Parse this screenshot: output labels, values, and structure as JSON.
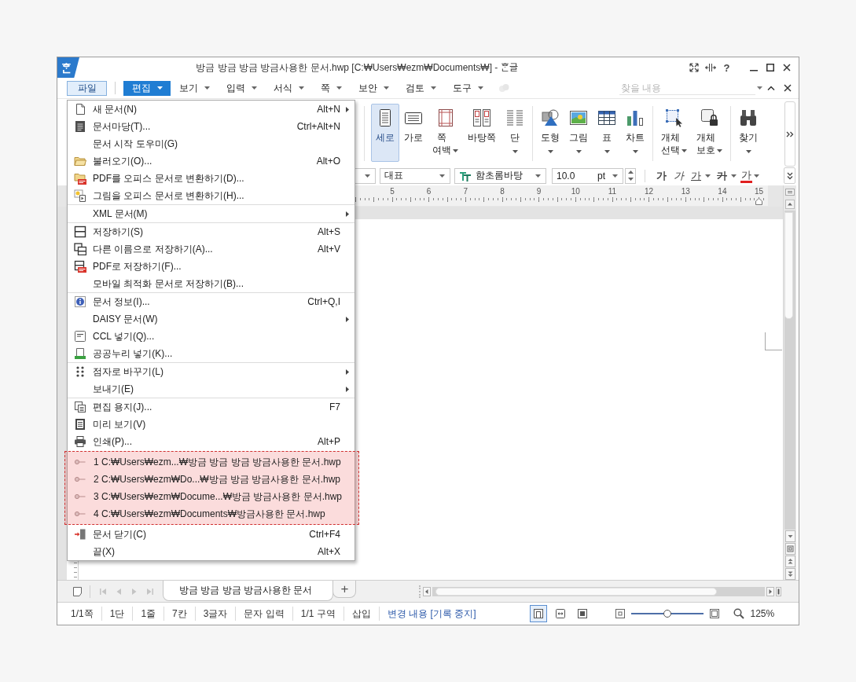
{
  "window": {
    "logo": "ᄒᆞᆫ",
    "title": "방금 방금 방금 방금사용한 문서.hwp [C:₩Users₩ezm₩Documents₩] - ᄒᆞᆫ글",
    "help": "?"
  },
  "menubar": {
    "file_button": "파일",
    "menus": [
      {
        "label": "편집",
        "selected": true
      },
      {
        "label": "보기",
        "selected": false
      },
      {
        "label": "입력",
        "selected": false
      },
      {
        "label": "서식",
        "selected": false
      },
      {
        "label": "쪽",
        "selected": false
      },
      {
        "label": "보안",
        "selected": false
      },
      {
        "label": "검토",
        "selected": false
      },
      {
        "label": "도구",
        "selected": false
      }
    ],
    "search": {
      "placeholder": "찾을 내용"
    }
  },
  "ribbon": {
    "groups": [
      [
        {
          "label": "세로",
          "selected": true,
          "dropdown": false
        },
        {
          "label": "가로",
          "selected": false,
          "dropdown": false
        },
        {
          "label": "쪽 여백",
          "selected": false,
          "dropdown": true
        },
        {
          "label": "바탕쪽",
          "selected": false,
          "dropdown": false
        },
        {
          "label": "단",
          "selected": false,
          "dropdown": true
        }
      ],
      [
        {
          "label": "도형",
          "selected": false,
          "dropdown": true
        },
        {
          "label": "그림",
          "selected": false,
          "dropdown": true
        },
        {
          "label": "표",
          "selected": false,
          "dropdown": true
        },
        {
          "label": "차트",
          "selected": false,
          "dropdown": true
        }
      ],
      [
        {
          "label": "개체 선택",
          "selected": false,
          "dropdown": true
        },
        {
          "label": "개체 보호",
          "selected": false,
          "dropdown": true
        }
      ],
      [
        {
          "label": "찾기",
          "selected": false,
          "dropdown": true
        }
      ]
    ]
  },
  "format_bar": {
    "style": "대표",
    "font": "함초롬바탕",
    "size": "10.0",
    "unit": "pt",
    "char_buttons": [
      {
        "label": "가",
        "kind": "bold",
        "dropdown": false
      },
      {
        "label": "가",
        "kind": "italic",
        "dropdown": false
      },
      {
        "label": "가",
        "kind": "underline",
        "dropdown": true
      },
      {
        "label": "가",
        "kind": "strike",
        "dropdown": true
      },
      {
        "label": "가",
        "kind": "color",
        "dropdown": true
      }
    ]
  },
  "ruler": {
    "labels": [
      "5",
      "6",
      "7",
      "8",
      "9",
      "10",
      "11",
      "12",
      "13",
      "14",
      "15"
    ]
  },
  "file_menu": {
    "recent_highlighted": true,
    "groups": [
      [
        {
          "kind": "command",
          "label": "새 문서(N)",
          "shortcut": "Alt+N",
          "submenu": true
        },
        {
          "kind": "command",
          "label": "문서마당(T)...",
          "shortcut": "Ctrl+Alt+N",
          "submenu": false
        },
        {
          "kind": "command",
          "label": "문서 시작 도우미(G)",
          "submenu": false
        },
        {
          "kind": "command",
          "label": "불러오기(O)...",
          "shortcut": "Alt+O",
          "submenu": false
        },
        {
          "kind": "command",
          "label": "PDF를 오피스 문서로 변환하기(D)...",
          "submenu": false
        },
        {
          "kind": "command",
          "label": "그림을 오피스 문서로 변환하기(H)...",
          "submenu": false
        }
      ],
      [
        {
          "kind": "command",
          "label": "XML 문서(M)",
          "submenu": true
        }
      ],
      [
        {
          "kind": "command",
          "label": "저장하기(S)",
          "shortcut": "Alt+S",
          "submenu": false
        },
        {
          "kind": "command",
          "label": "다른 이름으로 저장하기(A)...",
          "shortcut": "Alt+V",
          "submenu": false
        },
        {
          "kind": "command",
          "label": "PDF로 저장하기(F)...",
          "submenu": false
        },
        {
          "kind": "command",
          "label": "모바일 최적화 문서로 저장하기(B)...",
          "submenu": false
        }
      ],
      [
        {
          "kind": "command",
          "label": "문서 정보(I)...",
          "shortcut": "Ctrl+Q,I",
          "submenu": false
        },
        {
          "kind": "command",
          "label": "DAISY 문서(W)",
          "submenu": true
        },
        {
          "kind": "command",
          "label": "CCL 넣기(Q)...",
          "submenu": false
        },
        {
          "kind": "command",
          "label": "공공누리 넣기(K)...",
          "submenu": false
        }
      ],
      [
        {
          "kind": "command",
          "label": "점자로 바꾸기(L)",
          "submenu": true
        },
        {
          "kind": "command",
          "label": "보내기(E)",
          "submenu": true
        }
      ],
      [
        {
          "kind": "command",
          "label": "편집 용지(J)...",
          "shortcut": "F7",
          "submenu": false
        },
        {
          "kind": "command",
          "label": "미리 보기(V)",
          "submenu": false
        },
        {
          "kind": "command",
          "label": "인쇄(P)...",
          "shortcut": "Alt+P",
          "submenu": false
        },
        {
          "kind": "recent",
          "label": "1 C:₩Users₩ezm...₩방금 방금 방금 방금사용한 문서.hwp"
        },
        {
          "kind": "recent",
          "label": "2 C:₩Users₩ezm₩Do...₩방금 방금 방금사용한 문서.hwp"
        },
        {
          "kind": "recent",
          "label": "3 C:₩Users₩ezm₩Docume...₩방금 방금사용한 문서.hwp"
        },
        {
          "kind": "recent",
          "label": "4 C:₩Users₩ezm₩Documents₩방금사용한 문서.hwp"
        },
        {
          "kind": "command",
          "label": "문서 닫기(C)",
          "shortcut": "Ctrl+F4",
          "submenu": false
        },
        {
          "kind": "command",
          "label": "끝(X)",
          "shortcut": "Alt+X",
          "submenu": false
        }
      ]
    ]
  },
  "sheet_tabs": {
    "nav_disabled": true,
    "tabs": [
      {
        "label": "방금 방금 방금 방금사용한 문서",
        "selected": true
      }
    ],
    "add": "+"
  },
  "status_bar": {
    "items": [
      {
        "text": "1/1쪽",
        "kind": "field"
      },
      {
        "text": "1단",
        "kind": "field"
      },
      {
        "text": "1줄",
        "kind": "field"
      },
      {
        "text": "7칸",
        "kind": "field"
      },
      {
        "text": "3글자",
        "kind": "field"
      },
      {
        "text": "문자 입력",
        "kind": "field"
      },
      {
        "text": "1/1 구역",
        "kind": "field"
      },
      {
        "text": "삽입",
        "kind": "field"
      },
      {
        "text": "변경 내용 [기록 중지]",
        "kind": "link"
      }
    ],
    "views": [
      {
        "selected": true
      },
      {
        "selected": false
      },
      {
        "selected": false
      }
    ],
    "zoom": {
      "level": 0.5,
      "reading": "125%"
    }
  }
}
